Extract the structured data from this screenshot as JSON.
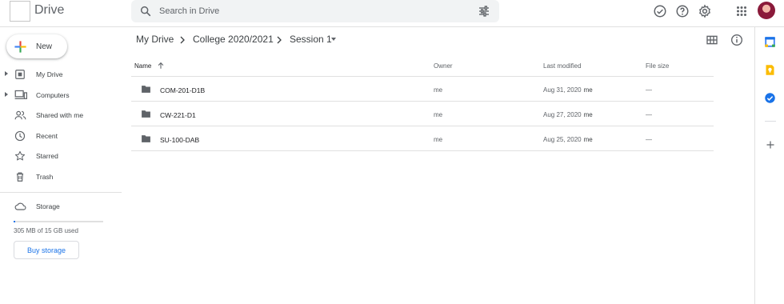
{
  "app": {
    "title": "Drive"
  },
  "search": {
    "placeholder": "Search in Drive"
  },
  "header_icons": [
    "offline-check-icon",
    "help-icon",
    "settings-icon",
    "apps-grid-icon"
  ],
  "new_button": {
    "label": "New"
  },
  "sidebar": {
    "items": [
      {
        "label": "My Drive",
        "icon": "my-drive-icon",
        "expandable": true
      },
      {
        "label": "Computers",
        "icon": "computers-icon",
        "expandable": true
      },
      {
        "label": "Shared with me",
        "icon": "shared-icon",
        "expandable": false
      },
      {
        "label": "Recent",
        "icon": "clock-icon",
        "expandable": false
      },
      {
        "label": "Starred",
        "icon": "star-icon",
        "expandable": false
      },
      {
        "label": "Trash",
        "icon": "trash-icon",
        "expandable": false
      }
    ],
    "storage": {
      "label": "Storage",
      "usage_text": "305 MB of 15 GB used",
      "used_fraction": 0.02,
      "buy_label": "Buy storage"
    }
  },
  "breadcrumb": {
    "items": [
      "My Drive",
      "College 2020/2021",
      "Session 1"
    ]
  },
  "table": {
    "columns": {
      "name": "Name",
      "owner": "Owner",
      "modified": "Last modified",
      "size": "File size"
    },
    "rows": [
      {
        "name": "COM-201-D1B",
        "owner": "me",
        "modified": "Aug 31, 2020",
        "modified_by": "me",
        "size": "—"
      },
      {
        "name": "CW-221-D1",
        "owner": "me",
        "modified": "Aug 27, 2020",
        "modified_by": "me",
        "size": "—"
      },
      {
        "name": "SU-100-DAB",
        "owner": "me",
        "modified": "Aug 25, 2020",
        "modified_by": "me",
        "size": "—"
      }
    ]
  },
  "colors": {
    "accent": "#1a73e8",
    "text": "#3c4043",
    "muted": "#5f6368",
    "divider": "#e0e0e0"
  }
}
